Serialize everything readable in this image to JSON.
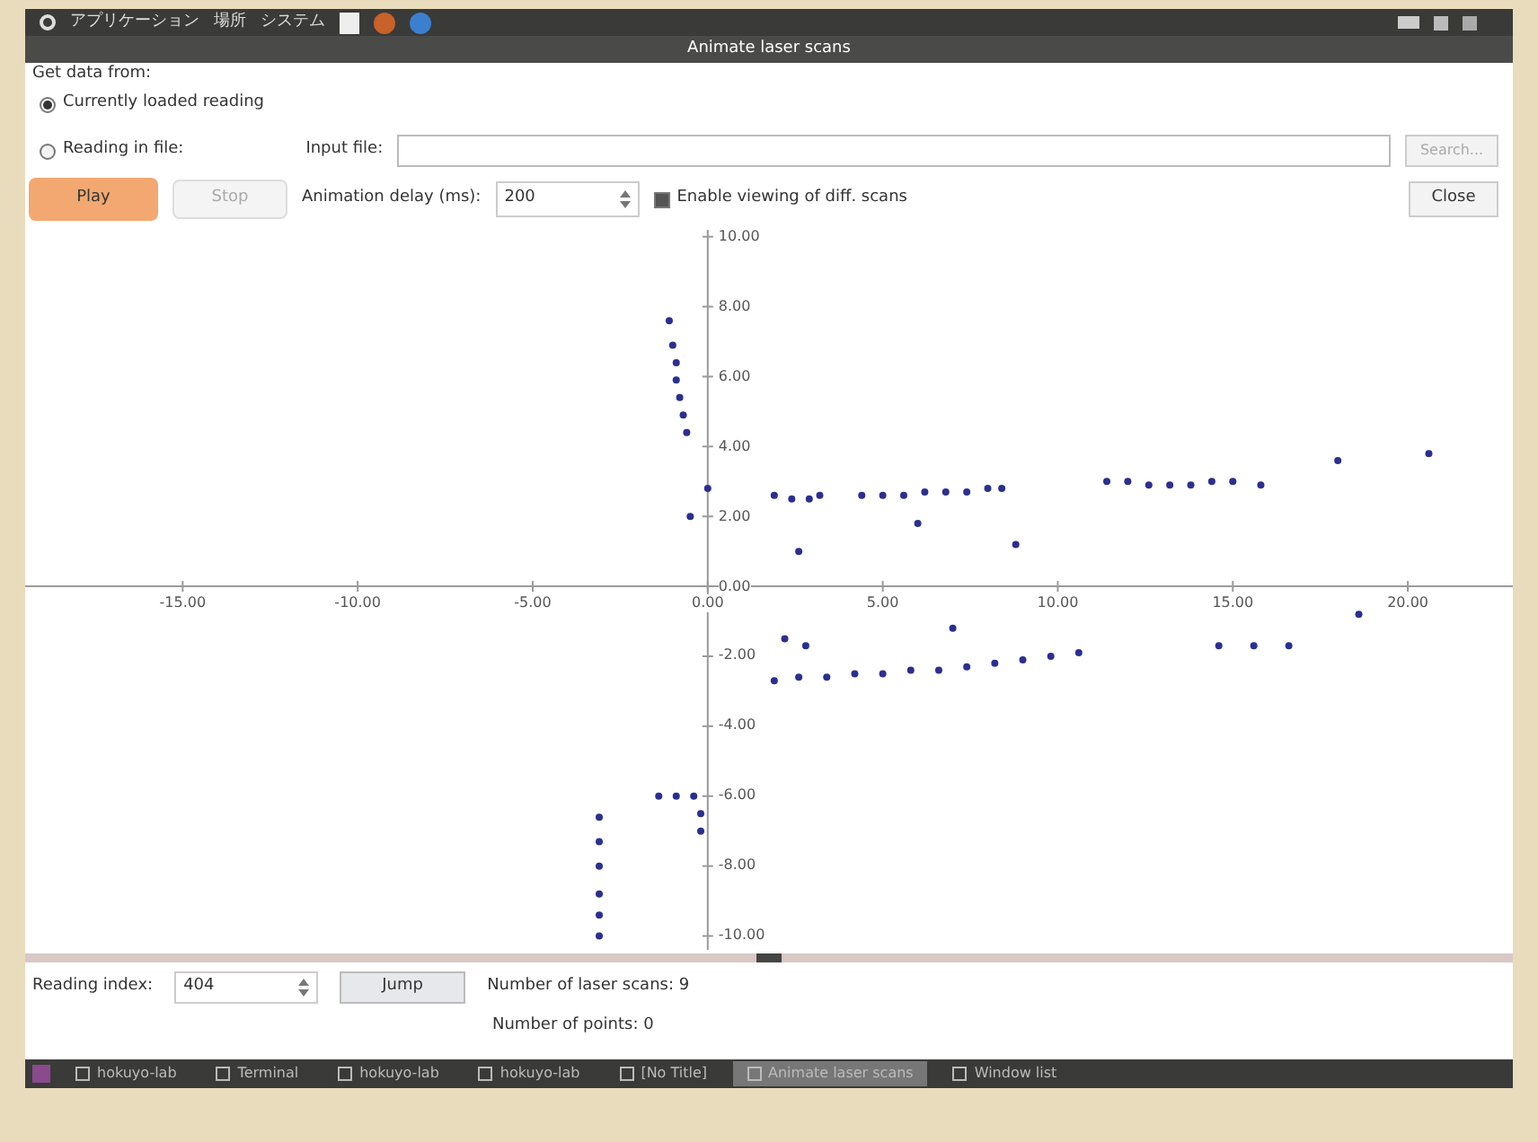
{
  "top_panel": {
    "menus": [
      "アプリケーション",
      "場所",
      "システム"
    ]
  },
  "window": {
    "title": "Animate laser scans"
  },
  "source": {
    "label": "Get data from:",
    "options": [
      {
        "label": "Currently loaded reading",
        "selected": true
      },
      {
        "label": "Reading in file:",
        "selected": false
      }
    ],
    "file_label": "Input file:",
    "browse": "Search..."
  },
  "controls": {
    "play": "Play",
    "stop": "Stop",
    "delay_label": "Animation delay (ms):",
    "delay": "200",
    "diff": {
      "label": "Enable viewing of diff. scans",
      "checked": true
    },
    "close": "Close"
  },
  "plot": {
    "chart_data": {
      "type": "scatter",
      "xlim": [
        -19.5,
        23
      ],
      "ylim": [
        -10.5,
        10.3
      ],
      "xticks": [
        {
          "value": -15,
          "label": "-15.00"
        },
        {
          "value": -10,
          "label": "-10.00"
        },
        {
          "value": -5,
          "label": "-5.00"
        },
        {
          "value": 0,
          "label": "0.00"
        },
        {
          "value": 5,
          "label": "5.00"
        },
        {
          "value": 10,
          "label": "10.00"
        },
        {
          "value": 15,
          "label": "15.00"
        },
        {
          "value": 20,
          "label": "20.00"
        }
      ],
      "yticks": [
        {
          "value": 10,
          "label": "10.00"
        },
        {
          "value": 8,
          "label": "8.00"
        },
        {
          "value": 6,
          "label": "6.00"
        },
        {
          "value": 4,
          "label": "4.00"
        },
        {
          "value": 2,
          "label": "2.00"
        },
        {
          "value": 0,
          "label": "0.00"
        },
        {
          "value": -2,
          "label": "-2.00"
        },
        {
          "value": -4,
          "label": "-4.00"
        },
        {
          "value": -6,
          "label": "-6.00"
        },
        {
          "value": -8,
          "label": "-8.00"
        },
        {
          "value": -10,
          "label": "-10.00"
        }
      ],
      "series": [
        {
          "color": "#2b2f8f",
          "x": [
            -1.1,
            -1.0,
            -0.9,
            -0.9,
            -0.8,
            -0.7,
            -0.6,
            0.0,
            1.9,
            2.4,
            2.9,
            3.2,
            4.4,
            5.0,
            5.6,
            6.2,
            6.8,
            7.4,
            8.0,
            8.4,
            11.4,
            12.0,
            12.6,
            13.2,
            13.8,
            14.4,
            15.0,
            15.8,
            6.0,
            8.8,
            2.6,
            -0.5,
            18.0,
            20.6,
            2.2,
            2.8,
            1.9,
            2.6,
            3.4,
            4.2,
            5.0,
            5.8,
            6.6,
            7.4,
            8.2,
            9.0,
            9.8,
            10.6,
            7.0,
            14.6,
            15.6,
            16.6,
            -3.1,
            -3.1,
            -3.1,
            -3.1,
            -3.1,
            -3.1,
            -1.4,
            -0.9,
            -0.4,
            -0.2,
            -0.2,
            18.6
          ],
          "values": [
            7.6,
            6.9,
            6.4,
            5.9,
            5.4,
            4.9,
            4.4,
            2.8,
            2.6,
            2.5,
            2.5,
            2.6,
            2.6,
            2.6,
            2.6,
            2.7,
            2.7,
            2.7,
            2.8,
            2.8,
            3.0,
            3.0,
            2.9,
            2.9,
            2.9,
            3.0,
            3.0,
            2.9,
            1.8,
            1.2,
            1.0,
            2.0,
            3.6,
            3.8,
            -1.5,
            -1.7,
            -2.7,
            -2.6,
            -2.6,
            -2.5,
            -2.5,
            -2.4,
            -2.4,
            -2.3,
            -2.2,
            -2.1,
            -2.0,
            -1.9,
            -1.2,
            -1.7,
            -1.7,
            -1.7,
            -6.6,
            -7.3,
            -8.0,
            -8.8,
            -9.4,
            -10.0,
            -6.0,
            -6.0,
            -6.0,
            -6.5,
            -7.0,
            -0.8
          ]
        }
      ]
    }
  },
  "bottom": {
    "index_label": "Reading index:",
    "index": "404",
    "jump": "Jump",
    "scans": "Number of laser scans: 9",
    "points": "Number of points: 0"
  },
  "taskbar": [
    "hokuyo-lab",
    "Terminal",
    "hokuyo-lab",
    "hokuyo-lab",
    "[No Title]",
    "Animate laser scans",
    "Window list"
  ]
}
